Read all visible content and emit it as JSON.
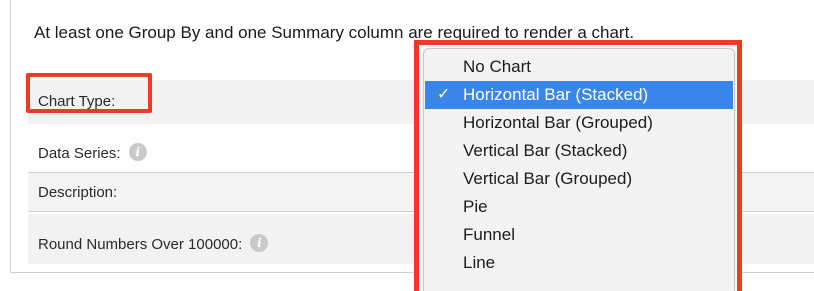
{
  "notice": "At least one Group By and one Summary column are required to render a chart.",
  "fields": [
    {
      "label": "Chart Type:",
      "info": false
    },
    {
      "label": "Data Series:",
      "info": true
    },
    {
      "label": "Description:",
      "info": false
    },
    {
      "label": "Round Numbers Over 100000:",
      "info": true
    }
  ],
  "info_icon_glyph": "i",
  "dropdown": {
    "selected": "Horizontal Bar (Stacked)",
    "check_glyph": "✓",
    "options": [
      "No Chart",
      "Horizontal Bar (Stacked)",
      "Horizontal Bar (Grouped)",
      "Vertical Bar (Stacked)",
      "Vertical Bar (Grouped)",
      "Pie",
      "Funnel",
      "Line"
    ]
  },
  "colors": {
    "annotation_red": "#ee3b24",
    "selection_blue": "#3a86ea",
    "row_gray": "#f2f2f2"
  }
}
